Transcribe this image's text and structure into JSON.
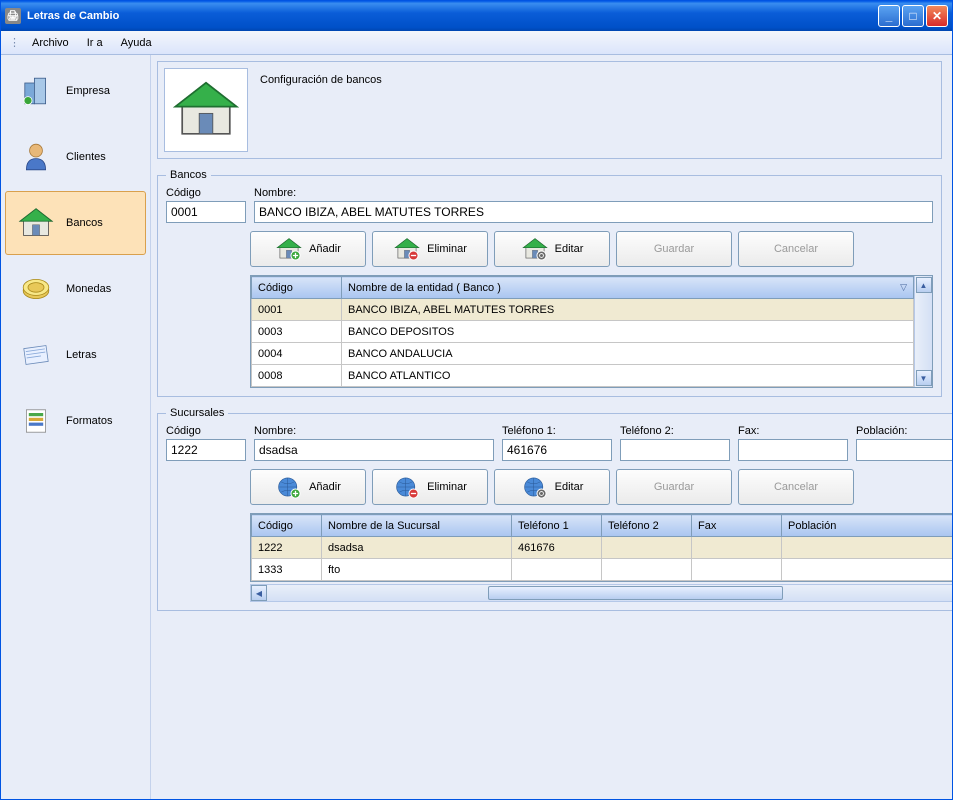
{
  "window": {
    "title": "Letras de Cambio"
  },
  "menu": {
    "archivo": "Archivo",
    "ira": "Ir a",
    "ayuda": "Ayuda"
  },
  "sidebar": {
    "items": [
      {
        "label": "Empresa"
      },
      {
        "label": "Clientes"
      },
      {
        "label": "Bancos"
      },
      {
        "label": "Monedas"
      },
      {
        "label": "Letras"
      },
      {
        "label": "Formatos"
      }
    ]
  },
  "header": {
    "title": "Configuración de bancos"
  },
  "bancos": {
    "legend": "Bancos",
    "codigo_label": "Código",
    "nombre_label": "Nombre:",
    "codigo_value": "0001",
    "nombre_value": "BANCO IBIZA, ABEL MATUTES TORRES",
    "buttons": {
      "anadir": "Añadir",
      "eliminar": "Eliminar",
      "editar": "Editar",
      "guardar": "Guardar",
      "cancelar": "Cancelar"
    },
    "cols": {
      "codigo": "Código",
      "nombre": "Nombre de la entidad ( Banco )"
    },
    "rows": [
      {
        "codigo": "0001",
        "nombre": "BANCO IBIZA, ABEL MATUTES TORRES"
      },
      {
        "codigo": "0003",
        "nombre": "BANCO DEPOSITOS"
      },
      {
        "codigo": "0004",
        "nombre": "BANCO ANDALUCIA"
      },
      {
        "codigo": "0008",
        "nombre": "BANCO ATLANTICO"
      }
    ]
  },
  "sucursales": {
    "legend": "Sucursales",
    "labels": {
      "codigo": "Código",
      "nombre": "Nombre:",
      "tel1": "Teléfono 1:",
      "tel2": "Teléfono 2:",
      "fax": "Fax:",
      "poblacion": "Población:"
    },
    "values": {
      "codigo": "1222",
      "nombre": "dsadsa",
      "tel1": "461676",
      "tel2": "",
      "fax": "",
      "poblacion": ""
    },
    "buttons": {
      "anadir": "Añadir",
      "eliminar": "Eliminar",
      "editar": "Editar",
      "guardar": "Guardar",
      "cancelar": "Cancelar"
    },
    "cols": {
      "codigo": "Código",
      "nombre": "Nombre de la Sucursal",
      "tel1": "Teléfono 1",
      "tel2": "Teléfono 2",
      "fax": "Fax",
      "poblacion": "Población"
    },
    "rows": [
      {
        "codigo": "1222",
        "nombre": "dsadsa",
        "tel1": "461676",
        "tel2": "",
        "fax": "",
        "poblacion": ""
      },
      {
        "codigo": "1333",
        "nombre": "fto",
        "tel1": "",
        "tel2": "",
        "fax": "",
        "poblacion": ""
      }
    ]
  }
}
